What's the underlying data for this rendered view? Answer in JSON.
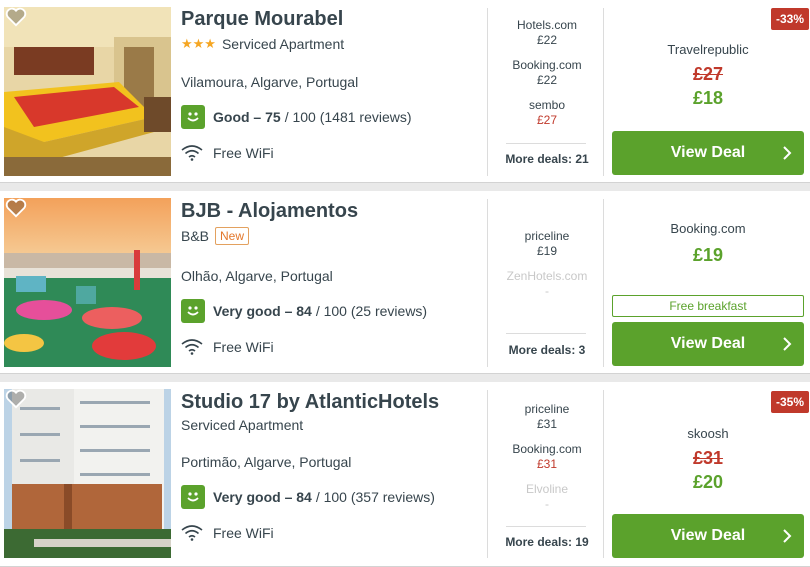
{
  "colors": {
    "accent_green": "#5ba22c",
    "price_red": "#c0392b",
    "star_orange": "#f5a623",
    "text": "#37454d"
  },
  "hotels": [
    {
      "name": "Parque Mourabel",
      "stars": "★★★",
      "type": "Serviced Apartment",
      "location": "Vilamoura, Algarve, Portugal",
      "rating_label": "Good – 75",
      "rating_rest": "/ 100 (1481 reviews)",
      "wifi": "Free WiFi",
      "deals": [
        {
          "provider": "Hotels.com",
          "price": "£22"
        },
        {
          "provider": "Booking.com",
          "price": "£22"
        },
        {
          "provider": "sembo",
          "price": "£27"
        }
      ],
      "more_deals": "More deals: 21",
      "discount": "-33%",
      "best_provider": "Travelrepublic",
      "old_price": "£27",
      "price": "£18",
      "cta": "View Deal"
    },
    {
      "name": "BJB - Alojamentos",
      "type": "B&B",
      "badge": "New",
      "location": "Olhão, Algarve, Portugal",
      "rating_label": "Very good – 84",
      "rating_rest": "/ 100 (25 reviews)",
      "wifi": "Free WiFi",
      "deals": [
        {
          "provider": "priceline",
          "price": "£19"
        },
        {
          "provider": "ZenHotels.com",
          "price": "-"
        }
      ],
      "more_deals": "More deals: 3",
      "best_provider": "Booking.com",
      "price": "£19",
      "perk": "Free breakfast",
      "cta": "View Deal"
    },
    {
      "name": "Studio 17 by AtlanticHotels",
      "type": "Serviced Apartment",
      "location": "Portimão, Algarve, Portugal",
      "rating_label": "Very good – 84",
      "rating_rest": "/ 100 (357 reviews)",
      "wifi": "Free WiFi",
      "deals": [
        {
          "provider": "priceline",
          "price": "£31"
        },
        {
          "provider": "Booking.com",
          "price": "£31"
        },
        {
          "provider": "Elvoline",
          "price": "-"
        }
      ],
      "more_deals": "More deals: 19",
      "discount": "-35%",
      "best_provider": "skoosh",
      "old_price": "£31",
      "price": "£20",
      "cta": "View Deal"
    }
  ]
}
